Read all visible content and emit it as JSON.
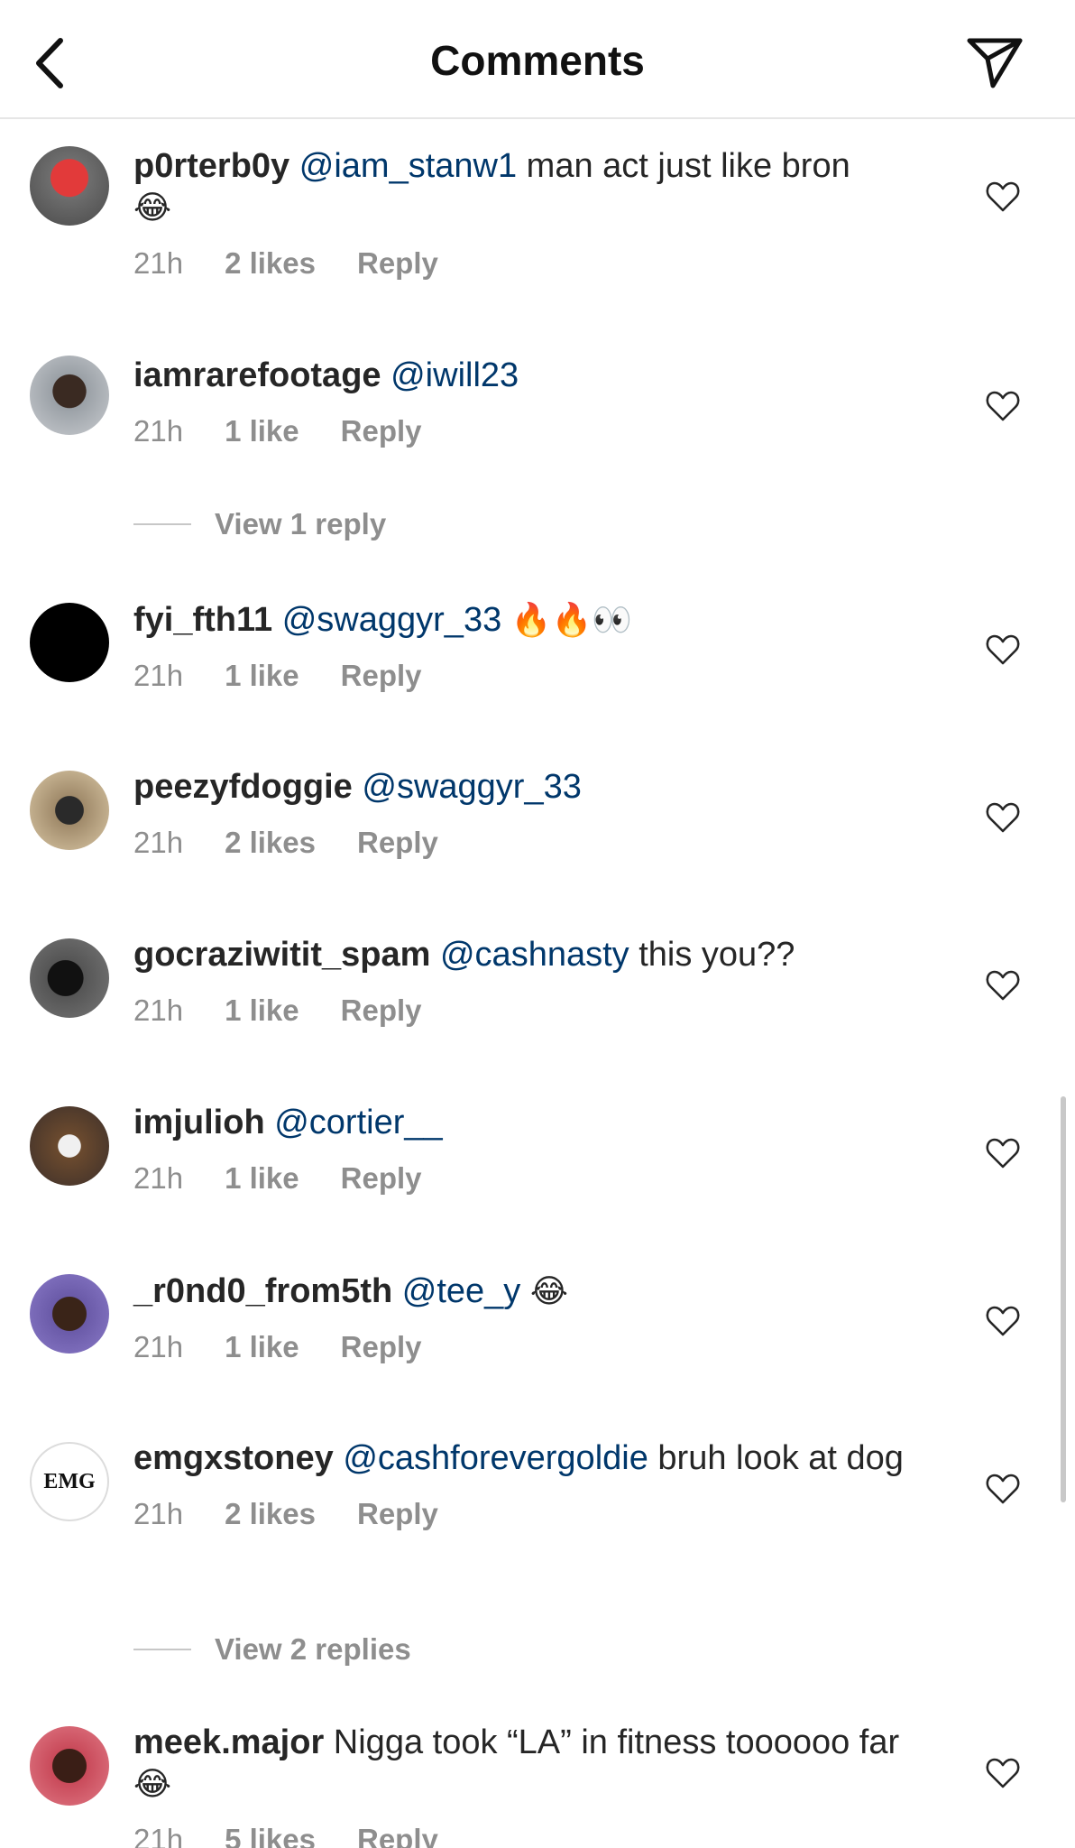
{
  "header": {
    "title": "Comments"
  },
  "comments": [
    {
      "username": "p0rterb0y",
      "mention": "@iam_stanw1",
      "text": "man act just like bron",
      "emoji": "😂",
      "time": "21h",
      "likes": "2 likes",
      "reply": "Reply"
    },
    {
      "username": "iamrarefootage",
      "mention": "@iwill23",
      "text": "",
      "emoji": "",
      "time": "21h",
      "likes": "1 like",
      "reply": "Reply"
    },
    {
      "username": "fyi_fth11",
      "mention": "@swaggyr_33",
      "text": "",
      "emoji": "🔥🔥👀",
      "time": "21h",
      "likes": "1 like",
      "reply": "Reply"
    },
    {
      "username": "peezyfdoggie",
      "mention": "@swaggyr_33",
      "text": "",
      "emoji": "",
      "time": "21h",
      "likes": "2 likes",
      "reply": "Reply"
    },
    {
      "username": "gocraziwitit_spam",
      "mention": "@cashnasty",
      "text": "this you??",
      "emoji": "",
      "time": "21h",
      "likes": "1 like",
      "reply": "Reply"
    },
    {
      "username": "imjulioh",
      "mention": "@cortier__",
      "text": "",
      "emoji": "",
      "time": "21h",
      "likes": "1 like",
      "reply": "Reply"
    },
    {
      "username": "_r0nd0_from5th",
      "mention": "@tee_y",
      "text": "",
      "emoji": "😂",
      "time": "21h",
      "likes": "1 like",
      "reply": "Reply"
    },
    {
      "username": "emgxstoney",
      "mention": "@cashforevergoldie",
      "text": "bruh look at dog",
      "emoji": "",
      "time": "21h",
      "likes": "2 likes",
      "reply": "Reply",
      "avatar_text": "EMG"
    },
    {
      "username": "meek.major",
      "mention": "",
      "text": "Nigga took “LA” in fitness toooooo far",
      "emoji": "😂",
      "time": "21h",
      "likes": "5 likes",
      "reply": "Reply"
    }
  ],
  "view_replies": [
    "View 1 reply",
    "View 2 replies"
  ],
  "colors": {
    "mention": "#00376b",
    "meta": "#8e8e8e",
    "text": "#262626"
  },
  "icons": [
    "back-chevron-icon",
    "send-icon",
    "heart-icon"
  ]
}
